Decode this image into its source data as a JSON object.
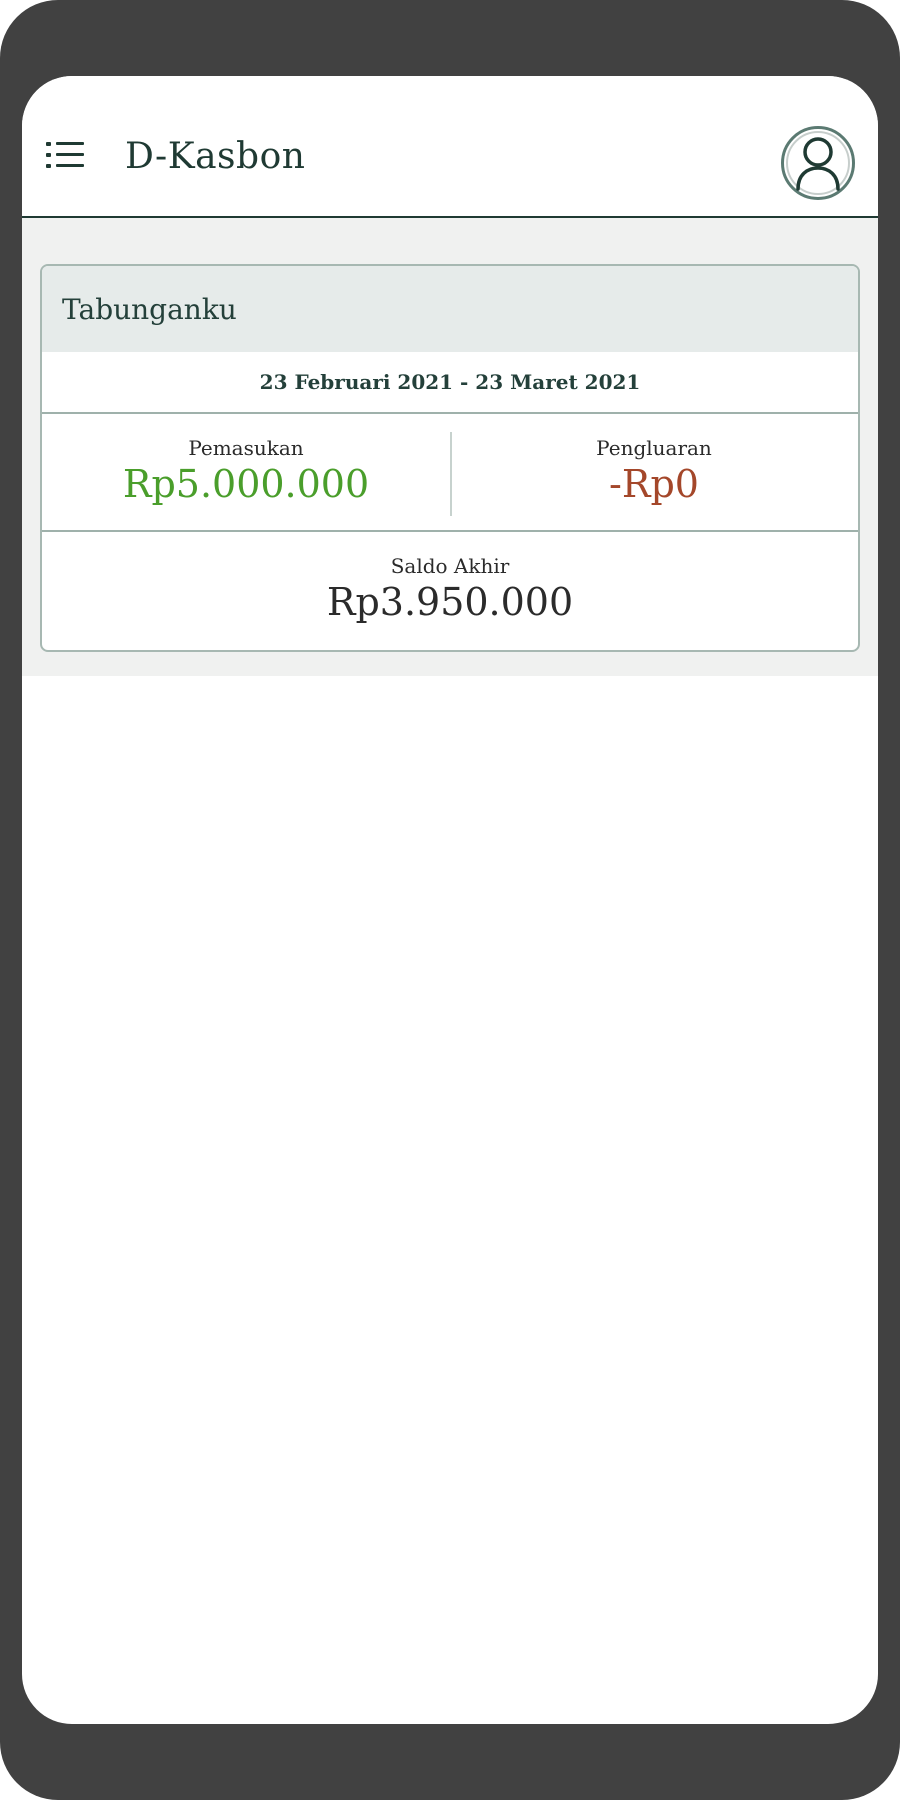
{
  "app": {
    "title": "D-Kasbon"
  },
  "card": {
    "title": "Tabunganku",
    "period": "23 Februari 2021 - 23 Maret 2021",
    "income": {
      "label": "Pemasukan",
      "value": "Rp5.000.000"
    },
    "expense": {
      "label": "Pengluaran",
      "value": "-Rp0"
    },
    "balance": {
      "label": "Saldo Akhir",
      "value": "Rp3.950.000"
    }
  },
  "icons": {
    "menu": "menu-list-icon",
    "avatar": "user-avatar-icon"
  },
  "colors": {
    "primary": "#1f3a33",
    "income": "#4a9e2b",
    "expense": "#a4472a",
    "background": "#f0f1f0"
  }
}
